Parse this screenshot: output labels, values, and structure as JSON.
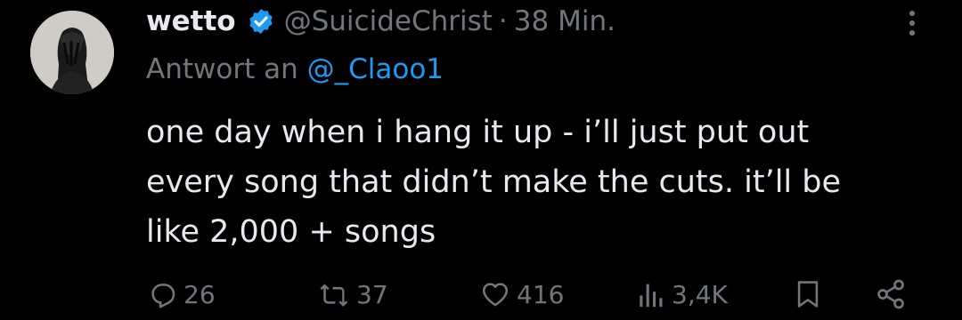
{
  "tweet": {
    "display_name": "wetto",
    "handle": "@SuicideChrist",
    "separator": "·",
    "time": "38 Min.",
    "reply_prefix": "Antwort an",
    "reply_handle": "@_Claoo1",
    "text_lines": [
      "one day when i hang it up - i’ll just put out",
      "every song that didn’t make the cuts. it’ll be",
      "like 2,000 + songs"
    ]
  },
  "actions": {
    "replies": "26",
    "reposts": "37",
    "likes": "416",
    "views": "3,4K"
  },
  "colors": {
    "background": "#000000",
    "text": "#e7e9ea",
    "muted": "#71767b",
    "accent": "#1d9bf0"
  },
  "icons": [
    "verified-badge-icon",
    "more-icon",
    "reply-icon",
    "repost-icon",
    "like-icon",
    "views-icon",
    "bookmark-icon",
    "share-icon"
  ]
}
